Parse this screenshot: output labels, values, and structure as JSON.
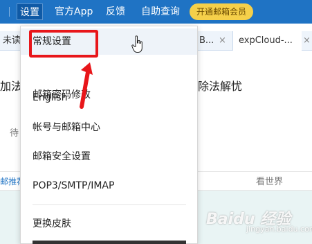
{
  "topnav": {
    "settings": "设置",
    "app": "官方App",
    "feedback": "反馈",
    "self_query": "自助查询",
    "vip": "开通邮箱会员"
  },
  "tabs": {
    "left": "未读",
    "middle_fragment": "B...",
    "right": "expCloud-..."
  },
  "background": {
    "line1_left": "加法",
    "line1_right": "除法解忧",
    "pending": "待",
    "row_left": "邮推荐",
    "row_right": "看世界"
  },
  "menu": {
    "items": [
      "常规设置",
      "邮箱密码修改",
      "English",
      "帐号与邮箱中心",
      "邮箱安全设置",
      "POP3/SMTP/IMAP",
      "更换皮肤"
    ]
  },
  "watermark": {
    "brand": "Baidu 经验",
    "sub": "jingyan.baidu.com"
  },
  "colors": {
    "nav_blue": "#1f73c4",
    "vip_yellow": "#f5d04a",
    "annotation_red": "#e8161a"
  }
}
